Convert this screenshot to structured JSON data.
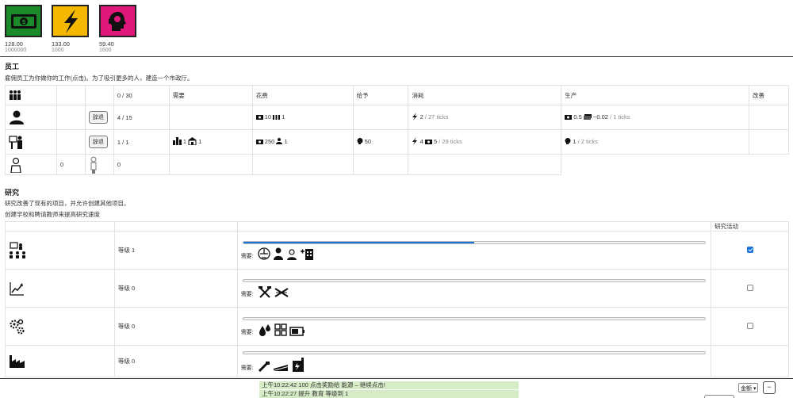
{
  "resources": [
    {
      "name": "money",
      "icon": "money-icon",
      "color": "#1a8a2a",
      "value": "128.00",
      "cap": "1000000"
    },
    {
      "name": "energy",
      "icon": "lightning-icon",
      "color": "#f5b800",
      "value": "133.00",
      "cap": "1000"
    },
    {
      "name": "brain",
      "icon": "head-icon",
      "color": "#e0187a",
      "value": "59.40",
      "cap": "1600"
    }
  ],
  "workers": {
    "title": "员工",
    "desc": "雇佣员工为你做你的工作(点击)。为了吸引更多的人，建造一个市政厅。",
    "headers": {
      "need": "需要",
      "cost": "花费",
      "give": "给予",
      "consume": "消耗",
      "produce": "生产",
      "improve": "改善"
    },
    "pop_total": "0 / 30",
    "rows": [
      {
        "count": "4 / 15",
        "fire": "辞退",
        "cost_a": "10",
        "cost_b": "1",
        "consume_a": "2",
        "consume_b": "/ 27 ticks",
        "prod_a": "0.5",
        "prod_b": "−0.02",
        "prod_c": "/ 1 ticks"
      },
      {
        "count": "1 / 1",
        "fire": "辞退",
        "need_a": "1",
        "need_b": "1",
        "cost_a": "250",
        "cost_b": "1",
        "give_a": "50",
        "consume_a": "4",
        "consume_b": "5",
        "consume_c": "/ 29 ticks",
        "prod_a": "1",
        "prod_b": "/ 2 ticks"
      },
      {
        "count_a": "0",
        "count_b": "0"
      }
    ]
  },
  "research": {
    "title": "研究",
    "desc1": "研究改善了现有的项目，并允许创建其他项目。",
    "desc2": "创建学校和聘请教师来提高研究速度",
    "active_header": "研究活动",
    "need_label": "需要:",
    "rows": [
      {
        "level": "等级 1",
        "progress": 0.5,
        "active": true
      },
      {
        "level": "等级 0",
        "progress": 0,
        "active": false
      },
      {
        "level": "等级 0",
        "progress": 0,
        "active": false
      },
      {
        "level": "等级 0",
        "progress": 0,
        "active": false
      }
    ]
  },
  "log": [
    "上午10:22:42 100 点击奖励给 能源 – 继续点击!",
    "上午10:22:27 提升 教育 等级到 1"
  ],
  "footer": {
    "select_value": "金额",
    "minus": "−"
  }
}
